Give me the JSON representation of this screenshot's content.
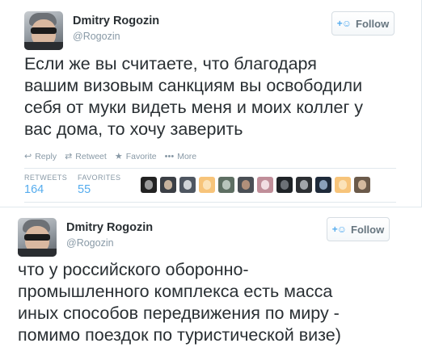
{
  "tweet1": {
    "name": "Dmitry Rogozin",
    "handle": "@Rogozin",
    "follow_label": "Follow",
    "text_lines": [
      "Если же вы считаете, что благодаря",
      "вашим визовым санкциям вы освободили",
      "себя от муки видеть меня и моих коллег у",
      "вас дома, то хочу заверить"
    ],
    "actions": [
      {
        "icon": "reply-icon",
        "glyph": "↩",
        "label": "Reply"
      },
      {
        "icon": "retweet-icon",
        "glyph": "⇄",
        "label": "Retweet"
      },
      {
        "icon": "star-icon",
        "glyph": "★",
        "label": "Favorite"
      },
      {
        "icon": "more-icon",
        "glyph": "•••",
        "label": "More"
      }
    ],
    "retweets_label": "RETWEETS",
    "retweets_count": "164",
    "favorites_label": "FAVORITES",
    "favorites_count": "55",
    "favoriter_avatars": [
      {
        "bg": "#222222",
        "dot": "#9a9a9a"
      },
      {
        "bg": "#3b3f45",
        "dot": "#c7b29c"
      },
      {
        "bg": "#4e5661",
        "dot": "#d0d4d8"
      },
      {
        "bg": "#f7c47a",
        "dot": "#fbe2b8"
      },
      {
        "bg": "#5e6f63",
        "dot": "#b8c4bc"
      },
      {
        "bg": "#4a4f55",
        "dot": "#b08f7a"
      },
      {
        "bg": "#c08e99",
        "dot": "#f1dde2"
      },
      {
        "bg": "#1f2327",
        "dot": "#6c7177"
      },
      {
        "bg": "#2c2f33",
        "dot": "#a1a5aa"
      },
      {
        "bg": "#1e2a3a",
        "dot": "#8aa0ba"
      },
      {
        "bg": "#f7c47a",
        "dot": "#fbe2b8"
      },
      {
        "bg": "#6b5a4a",
        "dot": "#d4b99e"
      }
    ]
  },
  "tweet2": {
    "name": "Dmitry Rogozin",
    "handle": "@Rogozin",
    "follow_label": "Follow",
    "text_lines": [
      "что у российского оборонно-",
      "промышленного комплекса есть масса",
      "иных способов передвижения по миру -",
      "помимо поездок по туристической визе)"
    ]
  },
  "colors": {
    "link_blue": "#55acee",
    "muted_gray": "#8899a6",
    "text_dark": "#292f33"
  }
}
